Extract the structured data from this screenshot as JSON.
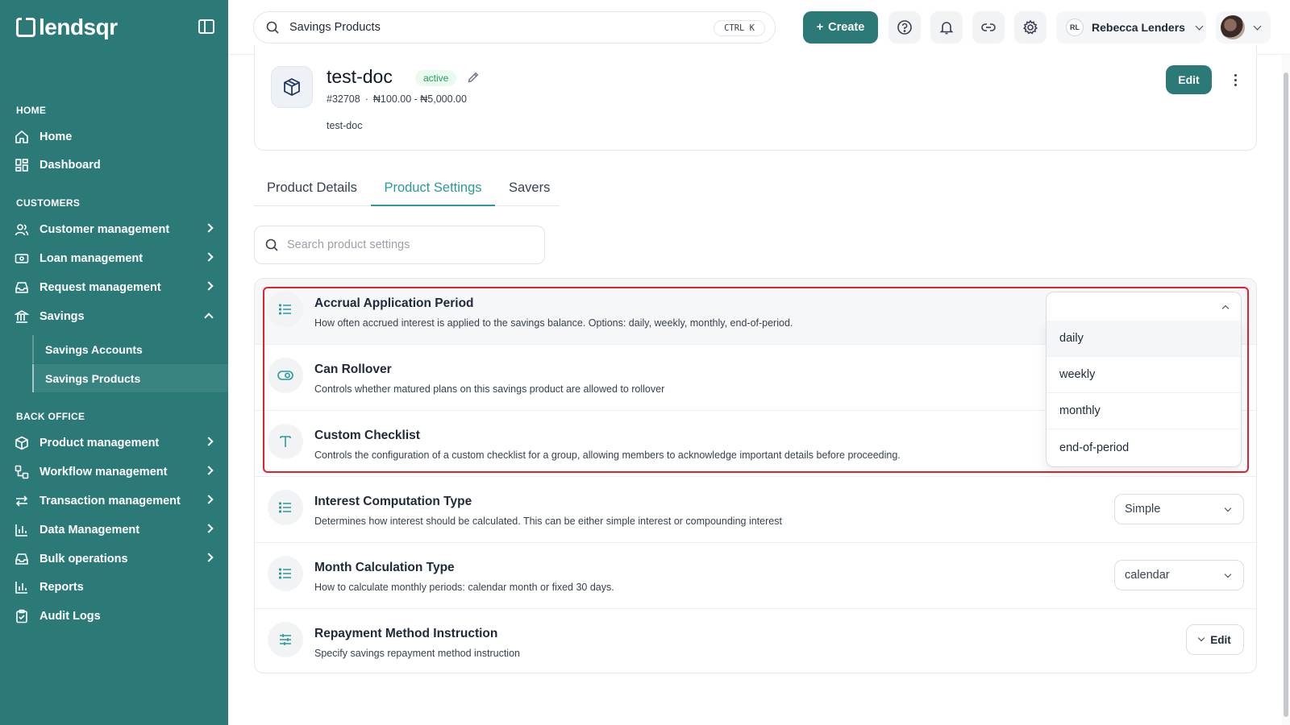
{
  "brand": {
    "name": "lendsqr",
    "accent": "#2b7a78",
    "highlight": "#e0232e"
  },
  "sidebar": {
    "sections": {
      "home": "HOME",
      "customers": "CUSTOMERS",
      "back_office": "BACK OFFICE"
    },
    "items": {
      "home": "Home",
      "dashboard": "Dashboard",
      "customer_management": "Customer management",
      "loan_management": "Loan management",
      "request_management": "Request management",
      "savings": "Savings",
      "savings_accounts": "Savings Accounts",
      "savings_products": "Savings Products",
      "product_management": "Product management",
      "workflow_management": "Workflow management",
      "transaction_management": "Transaction management",
      "data_management": "Data Management",
      "bulk_operations": "Bulk operations",
      "reports": "Reports",
      "audit_logs": "Audit Logs"
    }
  },
  "topbar": {
    "search_value": "Savings Products",
    "shortcut": "CTRL K",
    "create_label": "Create",
    "user_initials": "RL",
    "user_name": "Rebecca Lenders"
  },
  "product": {
    "name": "test-doc",
    "status": "active",
    "id": "#32708",
    "separator": "·",
    "range": "₦100.00 - ₦5,000.00",
    "description": "test-doc",
    "edit_label": "Edit"
  },
  "tabs": {
    "details": "Product Details",
    "settings": "Product Settings",
    "savers": "Savers"
  },
  "settings_search": {
    "placeholder": "Search product settings"
  },
  "settings": {
    "accrual": {
      "title": "Accrual Application Period",
      "desc": "How often accrued interest is applied to the savings balance. Options: daily, weekly, monthly, end-of-period.",
      "options": [
        "daily",
        "weekly",
        "monthly",
        "end-of-period"
      ]
    },
    "rollover": {
      "title": "Can Rollover",
      "desc": "Controls whether matured plans on this savings product are allowed to rollover"
    },
    "checklist": {
      "title": "Custom Checklist",
      "desc": "Controls the configuration of a custom checklist for a group, allowing members to acknowledge important details before proceeding."
    },
    "interest": {
      "title": "Interest Computation Type",
      "desc": "Determines how interest should be calculated. This can be either simple interest or compounding interest",
      "value": "Simple"
    },
    "month": {
      "title": "Month Calculation Type",
      "desc": "How to calculate monthly periods: calendar month or fixed 30 days.",
      "value": "calendar"
    },
    "repayment": {
      "title": "Repayment Method Instruction",
      "desc": "Specify savings repayment method instruction",
      "button": "Edit"
    }
  }
}
